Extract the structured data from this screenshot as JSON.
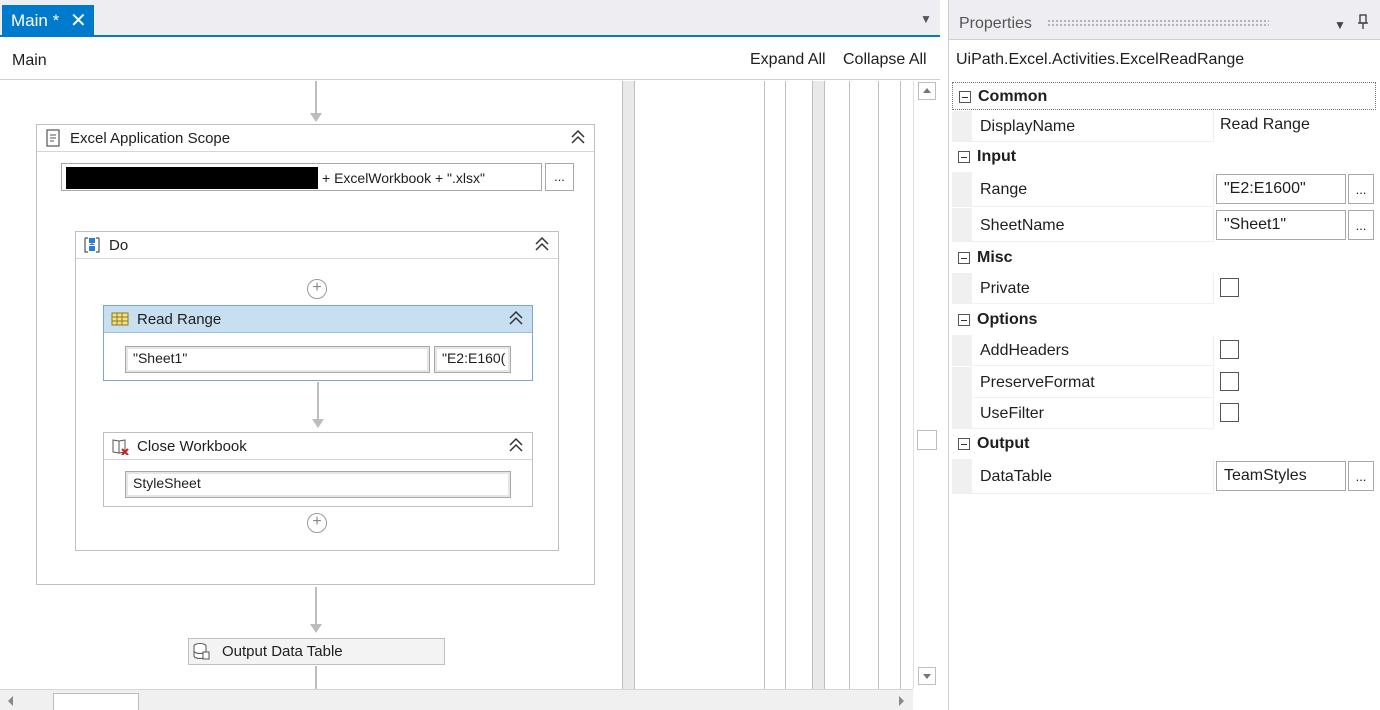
{
  "tabs": {
    "main_label": "Main *",
    "close_icon": "close-icon"
  },
  "breadcrumb": {
    "label": "Main"
  },
  "toolbar": {
    "expand_all": "Expand All",
    "collapse_all": "Collapse All"
  },
  "workflow": {
    "excel_scope": {
      "title": "Excel Application Scope",
      "path_value": "+ ExcelWorkbook + \".xlsx\"",
      "browse_label": "..."
    },
    "do": {
      "title": "Do"
    },
    "read_range": {
      "title": "Read Range",
      "sheet_value": "\"Sheet1\"",
      "range_value": "\"E2:E160("
    },
    "close_workbook": {
      "title": "Close Workbook",
      "workbook_value": "StyleSheet"
    },
    "output_data_table": {
      "title": "Output Data Table"
    }
  },
  "properties": {
    "panel_title": "Properties",
    "type_name": "UiPath.Excel.Activities.ExcelReadRange",
    "categories": {
      "common": "Common",
      "input": "Input",
      "misc": "Misc",
      "options": "Options",
      "output": "Output"
    },
    "rows": {
      "display_name": {
        "name": "DisplayName",
        "value": "Read Range"
      },
      "range": {
        "name": "Range",
        "value": "\"E2:E1600\""
      },
      "sheet_name": {
        "name": "SheetName",
        "value": "\"Sheet1\""
      },
      "private": {
        "name": "Private",
        "checked": false
      },
      "add_headers": {
        "name": "AddHeaders",
        "checked": false
      },
      "preserve_format": {
        "name": "PreserveFormat",
        "checked": false
      },
      "use_filter": {
        "name": "UseFilter",
        "checked": false
      },
      "data_table": {
        "name": "DataTable",
        "value": "TeamStyles"
      }
    },
    "browse_label": "..."
  },
  "colors": {
    "accent": "#007acc",
    "selected_activity_header": "#c7dff0",
    "selected_activity_border": "#7aa7cf"
  }
}
